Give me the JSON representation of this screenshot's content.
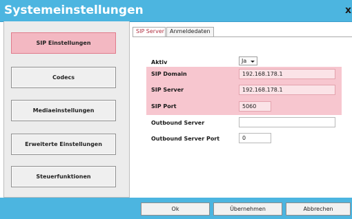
{
  "window": {
    "title": "Systemeinstellungen",
    "close_glyph": "x"
  },
  "nav": {
    "items": [
      {
        "label": "SIP Einstellungen",
        "active": true
      },
      {
        "label": "Codecs",
        "active": false
      },
      {
        "label": "Mediaeinstellungen",
        "active": false
      },
      {
        "label": "Erweiterte Einstellungen",
        "active": false
      },
      {
        "label": "Steuerfunktionen",
        "active": false
      }
    ]
  },
  "tabs": [
    {
      "label": "SIP Server",
      "active": true
    },
    {
      "label": "Anmeldedaten",
      "active": false
    }
  ],
  "form": {
    "aktiv": {
      "label": "Aktiv",
      "value": "Ja"
    },
    "sip_domain": {
      "label": "SIP Domain",
      "value": "192.168.178.1"
    },
    "sip_server": {
      "label": "SIP Server",
      "value": "192.168.178.1"
    },
    "sip_port": {
      "label": "SIP Port",
      "value": "5060"
    },
    "outbound_server": {
      "label": "Outbound Server",
      "value": ""
    },
    "outbound_server_port": {
      "label": "Outbound Server Port",
      "value": "0"
    }
  },
  "footer": {
    "ok_label": "Ok",
    "apply_label": "Übernehmen",
    "cancel_label": "Abbrechen"
  },
  "colors": {
    "titlebar": "#4cb5e0",
    "highlight": "#f7c6cf",
    "active_nav": "#f3b8c2"
  }
}
